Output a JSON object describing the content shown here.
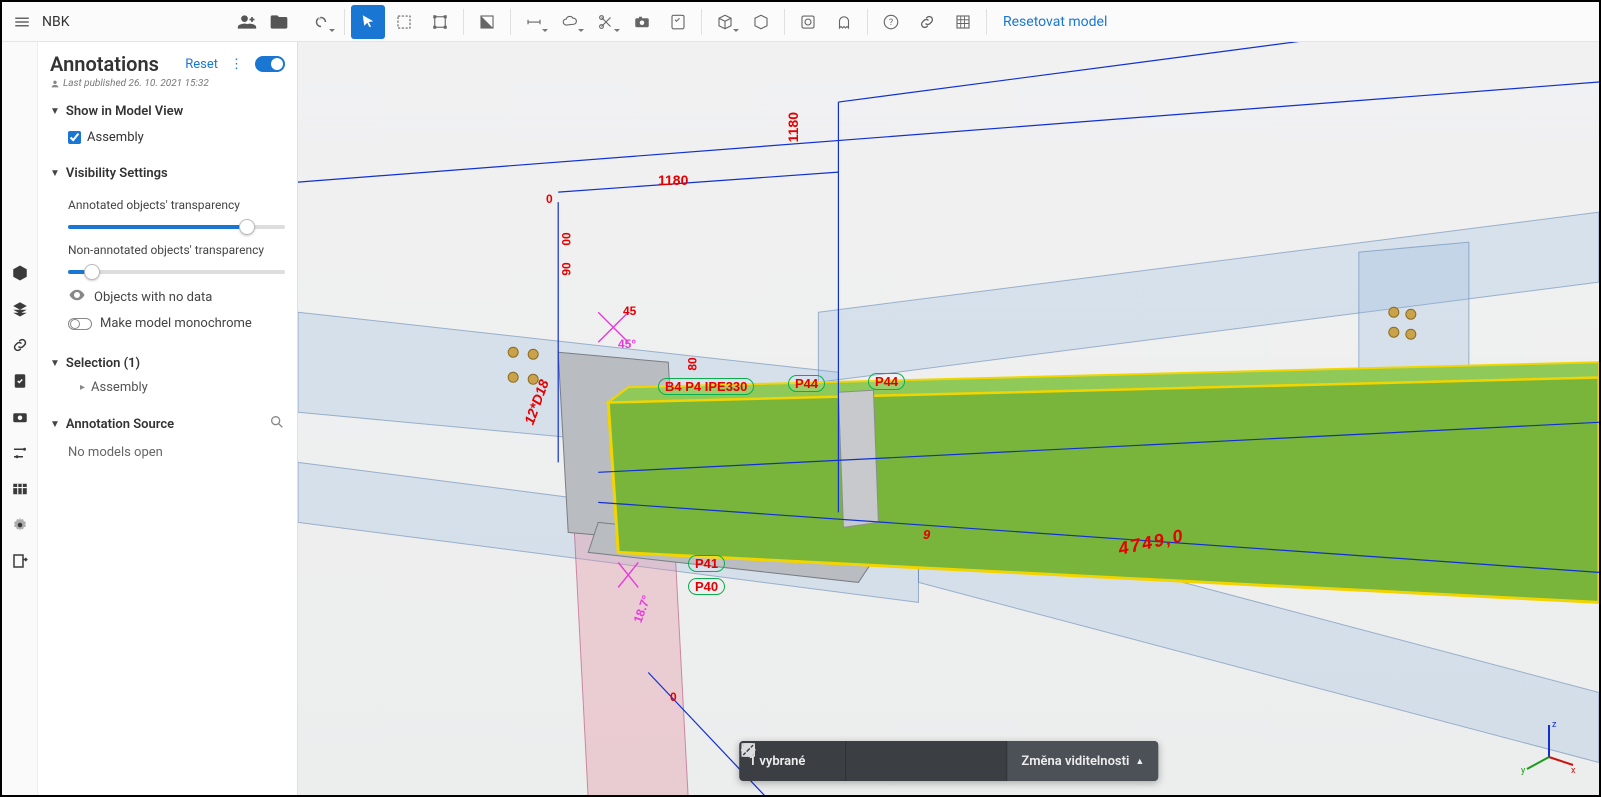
{
  "project": {
    "name": "NBK"
  },
  "toolbar": {
    "reset_model": "Resetovat model"
  },
  "panel": {
    "title": "Annotations",
    "reset": "Reset",
    "last_published": "Last published 26. 10. 2021 15:32",
    "show_in_model_view": "Show in Model View",
    "assembly": "Assembly",
    "visibility_settings": "Visibility Settings",
    "annotated_transparency": "Annotated objects' transparency",
    "annotated_transparency_value": 85,
    "non_annotated_transparency": "Non-annotated objects' transparency",
    "non_annotated_transparency_value": 8,
    "objects_no_data": "Objects with no data",
    "monochrome": "Make model monochrome",
    "selection": "Selection (1)",
    "selection_sub": "Assembly",
    "annotation_source": "Annotation Source",
    "no_models_open": "No models open"
  },
  "status": {
    "selected": "1 vybrané",
    "visibility": "Změna viditelnosti"
  },
  "model_labels": {
    "dim_1180_h": "1180",
    "dim_1180_v": "1180",
    "dim_4749": "4749,0",
    "lbl_12d18": "12*D18",
    "lbl_ipe330": "B4 P4 IPE330",
    "lbl_p44a": "P44",
    "lbl_p44b": "P44",
    "lbl_p41": "P41",
    "lbl_p40": "P40",
    "lbl_45": "45",
    "lbl_45deg": "45°",
    "lbl_80": "80",
    "lbl_90v": "90",
    "lbl_00v": "00",
    "lbl_0top": "0",
    "lbl_0bot": "0",
    "lbl_arrow9": "9",
    "lbl_187": "18.7°"
  },
  "gizmo": {
    "x": "x",
    "y": "y",
    "z": "z"
  }
}
